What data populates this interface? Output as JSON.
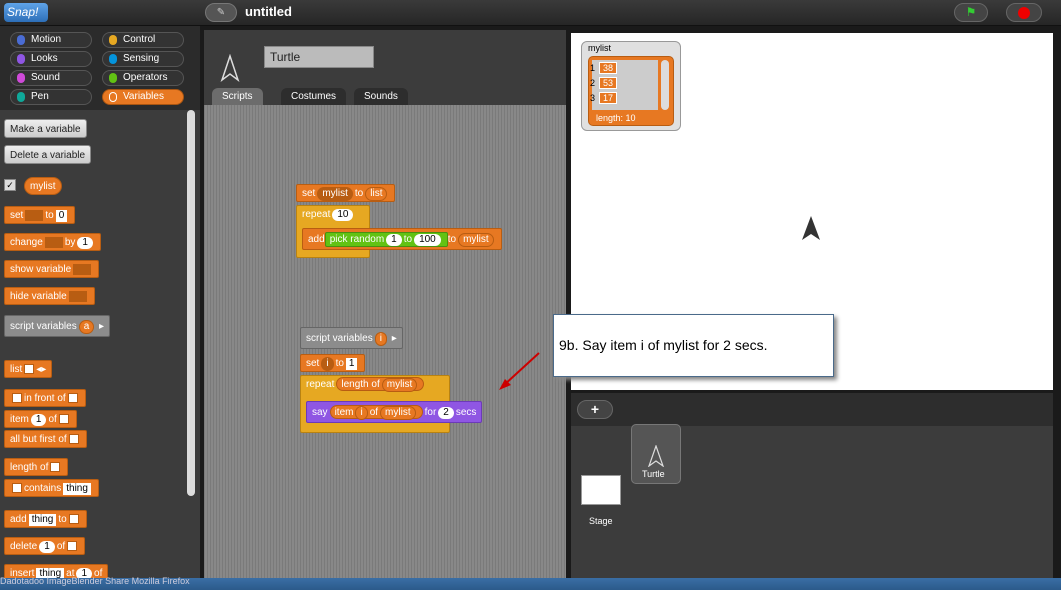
{
  "topbar": {
    "logo": "Snap!",
    "title": "untitled",
    "cloud_icon": "✎"
  },
  "categories": [
    {
      "label": "Motion",
      "color": "#4a6cd4"
    },
    {
      "label": "Looks",
      "color": "#8f56e3"
    },
    {
      "label": "Sound",
      "color": "#cf4ad9"
    },
    {
      "label": "Pen",
      "color": "#0fa899"
    },
    {
      "label": "Control",
      "color": "#e6a822"
    },
    {
      "label": "Sensing",
      "color": "#0494dc"
    },
    {
      "label": "Operators",
      "color": "#62c213"
    },
    {
      "label": "Variables",
      "color": "#e77822"
    }
  ],
  "palette": {
    "make_variable": "Make a variable",
    "delete_variable": "Delete a variable",
    "var_name": "mylist",
    "set": "set",
    "to": "to",
    "set_val": "0",
    "change": "change",
    "by": "by",
    "change_val": "1",
    "show_variable": "show variable",
    "hide_variable": "hide variable",
    "script_variables": "script variables",
    "sv_a": "a",
    "list": "list",
    "in_front_of": "in front of",
    "item": "item",
    "of": "of",
    "item_val": "1",
    "all_but_first_of": "all but first of",
    "length_of": "length of",
    "contains": "contains",
    "thing": "thing",
    "add": "add",
    "delete": "delete",
    "delete_val": "1",
    "insert": "insert",
    "at": "at",
    "insert_val": "1"
  },
  "sprite": {
    "name": "Turtle",
    "tabs": [
      "Scripts",
      "Costumes",
      "Sounds"
    ]
  },
  "script1": {
    "set": "set",
    "var": "mylist",
    "to": "to",
    "list": "list",
    "repeat": "repeat",
    "times": "10",
    "add": "add",
    "pick_random": "pick random",
    "from": "1",
    "to2": "to",
    "upto": "100",
    "to3": "to",
    "target": "mylist"
  },
  "script2": {
    "script_variables": "script variables",
    "i": "i",
    "set": "set",
    "var": "i",
    "to": "to",
    "val": "1",
    "repeat": "repeat",
    "length_of": "length of",
    "list": "mylist",
    "say": "say",
    "item": "item",
    "item_var": "i",
    "of": "of",
    "list2": "mylist",
    "for": "for",
    "secs_val": "2",
    "secs": "secs"
  },
  "callout": "9b.  Say item i of mylist for 2 secs.",
  "watcher": {
    "title": "mylist",
    "rows": [
      {
        "index": "1",
        "value": "38"
      },
      {
        "index": "2",
        "value": "53"
      },
      {
        "index": "3",
        "value": "17"
      }
    ],
    "length_label": "length: 10"
  },
  "corral": {
    "add": "+",
    "stage_label": "Stage",
    "turtle_label": "Turtle"
  },
  "taskbar": "Dadotadoo   ImageBlender      Share       Mozilla Firefox"
}
